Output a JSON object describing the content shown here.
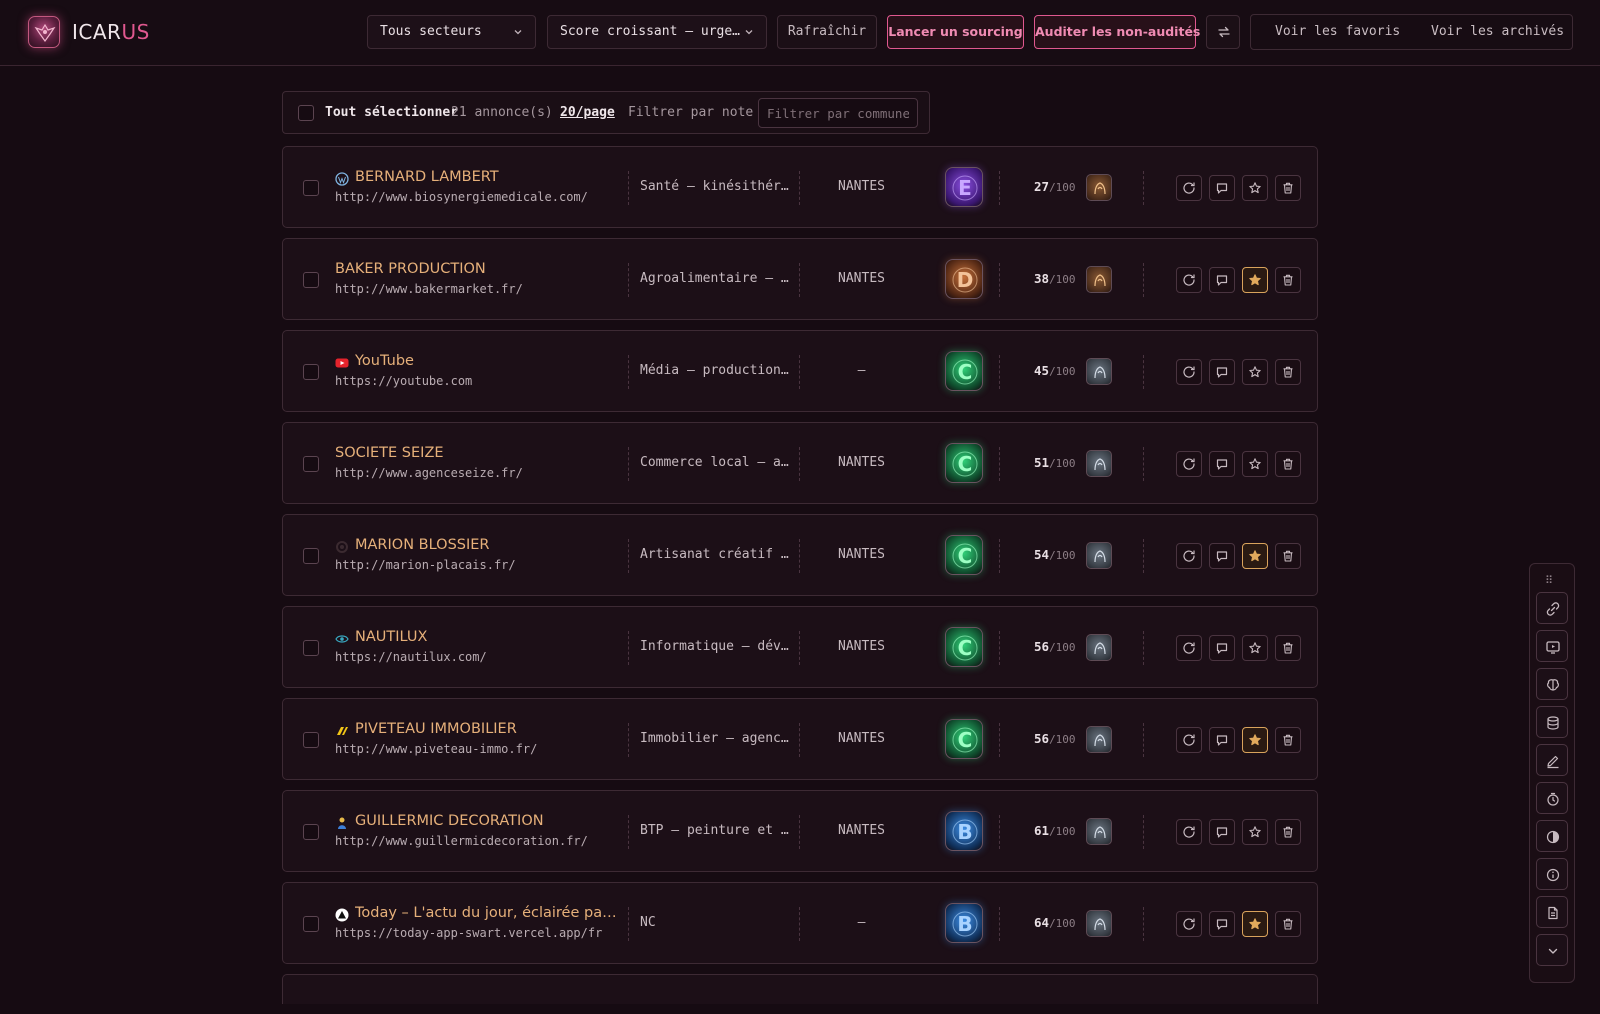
{
  "app": {
    "logo_prefix": "ICAR",
    "logo_accent": "US",
    "badge_text": "ICARUS"
  },
  "header": {
    "sector_select": "Tous secteurs",
    "sort_select": "Score croissant — urge…",
    "refresh_label": "Rafraîchir",
    "sourcing_label": "Lancer un sourcing",
    "audit_label": "Auditer les non-audités",
    "favorites_label": "Voir les favoris",
    "archived_label": "Voir les archivés"
  },
  "toolbar": {
    "select_all": "Tout sélectionner",
    "count": "21 annonce(s) ·",
    "per_page": "20/page",
    "filter_note": "Filtrer par note",
    "commune_placeholder": "Filtrer par commune…"
  },
  "rows": [
    {
      "name": "BERNARD LAMBERT",
      "url": "http://www.biosynergiemedicale.com/",
      "sector": "Santé — kinésithérapie",
      "city": "NANTES",
      "grade": "E",
      "score": "27",
      "total": "/100",
      "favicon": "wordpress-icon",
      "starred": false
    },
    {
      "name": "BAKER PRODUCTION",
      "url": "http://www.bakermarket.fr/",
      "sector": "Agroalimentaire — commerce",
      "city": "NANTES",
      "grade": "D",
      "score": "38",
      "total": "/100",
      "favicon": "",
      "starred": true
    },
    {
      "name": "YouTube",
      "url": "https://youtube.com",
      "sector": "Média — production vidéo",
      "city": "—",
      "grade": "C",
      "score": "45",
      "total": "/100",
      "favicon": "youtube-icon",
      "starred": false
    },
    {
      "name": "SOCIETE SEIZE",
      "url": "http://www.agenceseize.fr/",
      "sector": "Commerce local — automobile",
      "city": "NANTES",
      "grade": "C",
      "score": "51",
      "total": "/100",
      "favicon": "",
      "starred": false
    },
    {
      "name": "MARION BLOSSIER",
      "url": "http://marion-placais.fr/",
      "sector": "Artisanat créatif — art",
      "city": "NANTES",
      "grade": "C",
      "score": "54",
      "total": "/100",
      "favicon": "circle-icon",
      "starred": true
    },
    {
      "name": "NAUTILUX",
      "url": "https://nautilux.com/",
      "sector": "Informatique — développement",
      "city": "NANTES",
      "grade": "C",
      "score": "56",
      "total": "/100",
      "favicon": "eye-icon",
      "starred": false
    },
    {
      "name": "PIVETEAU IMMOBILIER",
      "url": "http://www.piveteau-immo.fr/",
      "sector": "Immobilier — agences",
      "city": "NANTES",
      "grade": "C",
      "score": "56",
      "total": "/100",
      "favicon": "slash-icon",
      "starred": true
    },
    {
      "name": "GUILLERMIC DECORATION",
      "url": "http://www.guillermicdecoration.fr/",
      "sector": "BTP — peinture et vitrerie",
      "city": "NANTES",
      "grade": "B",
      "score": "61",
      "total": "/100",
      "favicon": "person-icon",
      "starred": false
    },
    {
      "name": "Today – L'actu du jour, éclairée par l'IA",
      "url": "https://today-app-swart.vercel.app/fr",
      "sector": "NC",
      "city": "—",
      "grade": "B",
      "score": "64",
      "total": "/100",
      "favicon": "triangle-icon",
      "starred": true
    }
  ],
  "colors": {
    "accent": "#e0588f",
    "name": "#e6b07a",
    "star": "#d9a35c",
    "bg": "#160b12"
  }
}
